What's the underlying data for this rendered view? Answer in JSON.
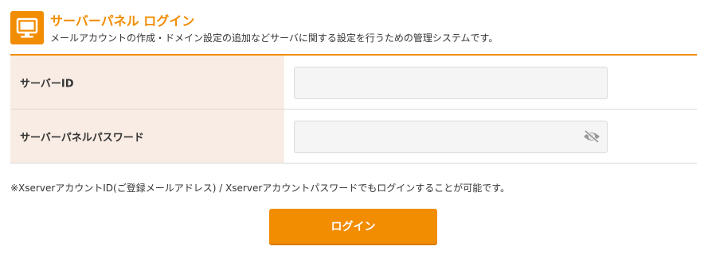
{
  "header": {
    "icon": "monitor-icon",
    "title": "サーバーパネル ログイン",
    "description": "メールアカウントの作成・ドメイン設定の追加などサーバに関する設定を行うための管理システムです。"
  },
  "form": {
    "server_id": {
      "label": "サーバーID",
      "value": "",
      "placeholder": ""
    },
    "password": {
      "label": "サーバーパネルパスワード",
      "value": "",
      "placeholder": "",
      "toggle_icon": "eye-slash-icon"
    }
  },
  "note": "※XserverアカウントID(ご登録メールアドレス) / Xserverアカウントパスワードでもログインすることが可能です。",
  "login_button": {
    "label": "ログイン"
  },
  "colors": {
    "accent": "#f28c00",
    "label_background": "#f9ece4",
    "input_background": "#f5f5f5"
  }
}
